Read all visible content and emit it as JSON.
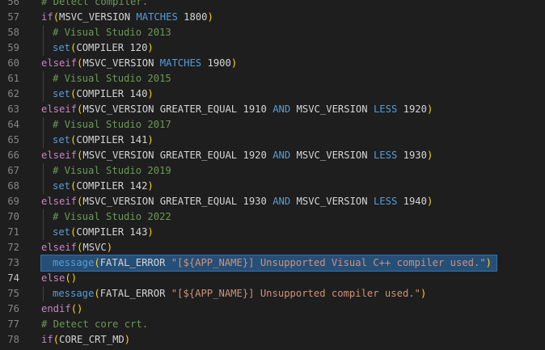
{
  "editor": {
    "colors": {
      "background": "#1e1e1e",
      "line_number": "#858585",
      "active_line_number": "#c6c6c6",
      "selection": "#264f78",
      "comment": "#6a9955",
      "keyword": "#c586c0",
      "operator": "#569cd6",
      "function": "#dcdcaa",
      "string": "#ce9178",
      "paren": "#ffd700",
      "plain": "#d4d4d4"
    },
    "active_line": 74,
    "selected_line": 73,
    "lines": [
      {
        "n": "56",
        "indent": 0,
        "tokens": [
          {
            "t": "# Detect compiler.",
            "c": "comment"
          }
        ]
      },
      {
        "n": "57",
        "indent": 0,
        "tokens": [
          {
            "t": "if",
            "c": "kw"
          },
          {
            "t": "(",
            "c": "paren"
          },
          {
            "t": "MSVC_VERSION ",
            "c": "plain"
          },
          {
            "t": "MATCHES",
            "c": "op"
          },
          {
            "t": " 1800",
            "c": "plain"
          },
          {
            "t": ")",
            "c": "paren"
          }
        ]
      },
      {
        "n": "58",
        "indent": 1,
        "tokens": [
          {
            "t": "# Visual Studio 2013",
            "c": "comment"
          }
        ]
      },
      {
        "n": "59",
        "indent": 1,
        "tokens": [
          {
            "t": "set",
            "c": "op"
          },
          {
            "t": "(",
            "c": "paren"
          },
          {
            "t": "COMPILER 120",
            "c": "plain"
          },
          {
            "t": ")",
            "c": "paren"
          }
        ]
      },
      {
        "n": "60",
        "indent": 0,
        "tokens": [
          {
            "t": "elseif",
            "c": "kw"
          },
          {
            "t": "(",
            "c": "paren"
          },
          {
            "t": "MSVC_VERSION ",
            "c": "plain"
          },
          {
            "t": "MATCHES",
            "c": "op"
          },
          {
            "t": " 1900",
            "c": "plain"
          },
          {
            "t": ")",
            "c": "paren"
          }
        ]
      },
      {
        "n": "61",
        "indent": 1,
        "tokens": [
          {
            "t": "# Visual Studio 2015",
            "c": "comment"
          }
        ]
      },
      {
        "n": "62",
        "indent": 1,
        "tokens": [
          {
            "t": "set",
            "c": "op"
          },
          {
            "t": "(",
            "c": "paren"
          },
          {
            "t": "COMPILER 140",
            "c": "plain"
          },
          {
            "t": ")",
            "c": "paren"
          }
        ]
      },
      {
        "n": "63",
        "indent": 0,
        "tokens": [
          {
            "t": "elseif",
            "c": "kw"
          },
          {
            "t": "(",
            "c": "paren"
          },
          {
            "t": "MSVC_VERSION GREATER_EQUAL 1910 ",
            "c": "plain"
          },
          {
            "t": "AND",
            "c": "op"
          },
          {
            "t": " MSVC_VERSION ",
            "c": "plain"
          },
          {
            "t": "LESS",
            "c": "op"
          },
          {
            "t": " 1920",
            "c": "plain"
          },
          {
            "t": ")",
            "c": "paren"
          }
        ]
      },
      {
        "n": "64",
        "indent": 1,
        "tokens": [
          {
            "t": "# Visual Studio 2017",
            "c": "comment"
          }
        ]
      },
      {
        "n": "65",
        "indent": 1,
        "tokens": [
          {
            "t": "set",
            "c": "op"
          },
          {
            "t": "(",
            "c": "paren"
          },
          {
            "t": "COMPILER 141",
            "c": "plain"
          },
          {
            "t": ")",
            "c": "paren"
          }
        ]
      },
      {
        "n": "66",
        "indent": 0,
        "tokens": [
          {
            "t": "elseif",
            "c": "kw"
          },
          {
            "t": "(",
            "c": "paren"
          },
          {
            "t": "MSVC_VERSION GREATER_EQUAL 1920 ",
            "c": "plain"
          },
          {
            "t": "AND",
            "c": "op"
          },
          {
            "t": " MSVC_VERSION ",
            "c": "plain"
          },
          {
            "t": "LESS",
            "c": "op"
          },
          {
            "t": " 1930",
            "c": "plain"
          },
          {
            "t": ")",
            "c": "paren"
          }
        ]
      },
      {
        "n": "67",
        "indent": 1,
        "tokens": [
          {
            "t": "# Visual Studio 2019",
            "c": "comment"
          }
        ]
      },
      {
        "n": "68",
        "indent": 1,
        "tokens": [
          {
            "t": "set",
            "c": "op"
          },
          {
            "t": "(",
            "c": "paren"
          },
          {
            "t": "COMPILER 142",
            "c": "plain"
          },
          {
            "t": ")",
            "c": "paren"
          }
        ]
      },
      {
        "n": "69",
        "indent": 0,
        "tokens": [
          {
            "t": "elseif",
            "c": "kw"
          },
          {
            "t": "(",
            "c": "paren"
          },
          {
            "t": "MSVC_VERSION GREATER_EQUAL 1930 ",
            "c": "plain"
          },
          {
            "t": "AND",
            "c": "op"
          },
          {
            "t": " MSVC_VERSION ",
            "c": "plain"
          },
          {
            "t": "LESS",
            "c": "op"
          },
          {
            "t": " 1940",
            "c": "plain"
          },
          {
            "t": ")",
            "c": "paren"
          }
        ]
      },
      {
        "n": "70",
        "indent": 1,
        "tokens": [
          {
            "t": "# Visual Studio 2022",
            "c": "comment"
          }
        ]
      },
      {
        "n": "71",
        "indent": 1,
        "tokens": [
          {
            "t": "set",
            "c": "op"
          },
          {
            "t": "(",
            "c": "paren"
          },
          {
            "t": "COMPILER 143",
            "c": "plain"
          },
          {
            "t": ")",
            "c": "paren"
          }
        ]
      },
      {
        "n": "72",
        "indent": 0,
        "tokens": [
          {
            "t": "elseif",
            "c": "kw"
          },
          {
            "t": "(",
            "c": "paren"
          },
          {
            "t": "MSVC",
            "c": "plain"
          },
          {
            "t": ")",
            "c": "paren"
          }
        ]
      },
      {
        "n": "73",
        "indent": 1,
        "tokens": [
          {
            "t": "message",
            "c": "op"
          },
          {
            "t": "(",
            "c": "paren"
          },
          {
            "t": "FATAL_ERROR ",
            "c": "plain"
          },
          {
            "t": "\"[${APP_NAME}] Unsupported Visual C++ compiler used.\"",
            "c": "str"
          },
          {
            "t": ")",
            "c": "paren"
          }
        ]
      },
      {
        "n": "74",
        "indent": 0,
        "tokens": [
          {
            "t": "else",
            "c": "kw"
          },
          {
            "t": "()",
            "c": "paren"
          }
        ]
      },
      {
        "n": "75",
        "indent": 1,
        "tokens": [
          {
            "t": "message",
            "c": "op"
          },
          {
            "t": "(",
            "c": "paren"
          },
          {
            "t": "FATAL_ERROR ",
            "c": "plain"
          },
          {
            "t": "\"[${APP_NAME}] Unsupported compiler used.\"",
            "c": "str"
          },
          {
            "t": ")",
            "c": "paren"
          }
        ]
      },
      {
        "n": "76",
        "indent": 0,
        "tokens": [
          {
            "t": "endif",
            "c": "kw"
          },
          {
            "t": "()",
            "c": "paren"
          }
        ]
      },
      {
        "n": "77",
        "indent": 0,
        "tokens": [
          {
            "t": "# Detect core crt.",
            "c": "comment"
          }
        ]
      },
      {
        "n": "78",
        "indent": 0,
        "tokens": [
          {
            "t": "if",
            "c": "kw"
          },
          {
            "t": "(",
            "c": "paren"
          },
          {
            "t": "CORE_CRT_MD",
            "c": "plain"
          },
          {
            "t": ")",
            "c": "paren"
          }
        ]
      }
    ]
  }
}
